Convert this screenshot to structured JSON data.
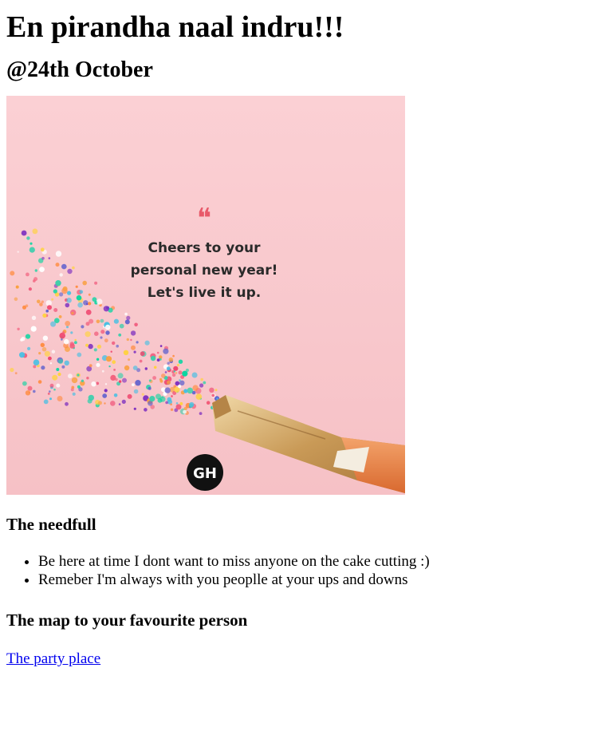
{
  "heading": "En pirandha naal indru!!!",
  "subheading": "@24th October",
  "card": {
    "quote_mark": "❝",
    "lines": [
      "Cheers to your",
      "personal new year!",
      "Let's live it up."
    ],
    "badge": "GH",
    "icon": "champagne-bottle-icon"
  },
  "needful": {
    "title": "The needfull",
    "items": [
      "Be here at time I dont want to miss anyone on the cake cutting :)",
      "Remeber I'm always with you peoplle at your ups and downs"
    ]
  },
  "map": {
    "title": "The map to your favourite person",
    "link_text": "The party place"
  },
  "colors": {
    "card_background": "#fbcfd3",
    "link": "#0000ee",
    "quote_mark": "#e85a6a"
  }
}
